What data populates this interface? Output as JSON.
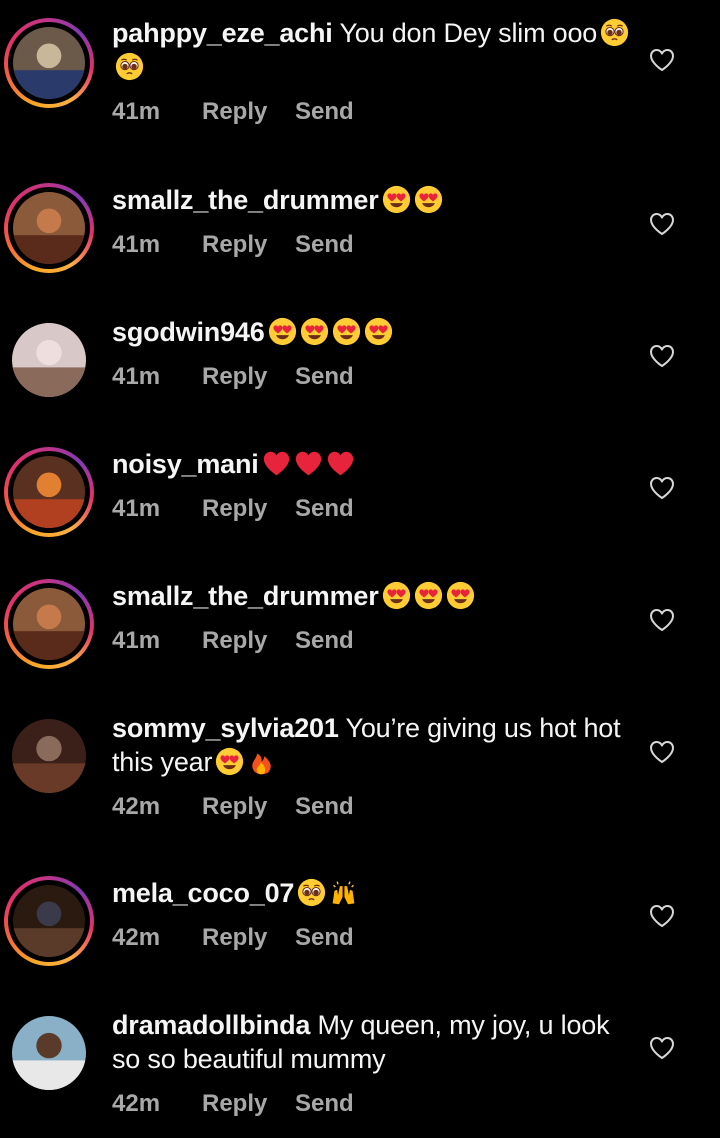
{
  "comments": [
    {
      "username": "pahppy_eze_achi",
      "text": "You don Dey slim ooo",
      "emojis": [
        "pleading-face",
        "pleading-face"
      ],
      "time": "41m",
      "reply": "Reply",
      "send": "Send",
      "story_ring": true
    },
    {
      "username": "smallz_the_drummer",
      "text": "",
      "emojis": [
        "heart-eyes",
        "heart-eyes"
      ],
      "time": "41m",
      "reply": "Reply",
      "send": "Send",
      "story_ring": true
    },
    {
      "username": "sgodwin946",
      "text": "",
      "emojis": [
        "heart-eyes",
        "heart-eyes",
        "heart-eyes",
        "heart-eyes"
      ],
      "time": "41m",
      "reply": "Reply",
      "send": "Send",
      "story_ring": false
    },
    {
      "username": "noisy_mani",
      "text": "",
      "emojis": [
        "red-heart",
        "red-heart",
        "red-heart"
      ],
      "time": "41m",
      "reply": "Reply",
      "send": "Send",
      "story_ring": true
    },
    {
      "username": "smallz_the_drummer",
      "text": "",
      "emojis": [
        "heart-eyes",
        "heart-eyes",
        "heart-eyes"
      ],
      "time": "41m",
      "reply": "Reply",
      "send": "Send",
      "story_ring": true
    },
    {
      "username": "sommy_sylvia201",
      "text": "You’re giving us hot hot this year",
      "emojis": [
        "heart-eyes",
        "fire"
      ],
      "time": "42m",
      "reply": "Reply",
      "send": "Send",
      "story_ring": false
    },
    {
      "username": "mela_coco_07",
      "text": "",
      "emojis": [
        "pleading-face",
        "raising-hands"
      ],
      "time": "42m",
      "reply": "Reply",
      "send": "Send",
      "story_ring": true
    },
    {
      "username": "dramadollbinda",
      "text": "My queen, my joy, u look so so beautiful mummy",
      "emojis": [],
      "time": "42m",
      "reply": "Reply",
      "send": "Send",
      "story_ring": false
    }
  ]
}
